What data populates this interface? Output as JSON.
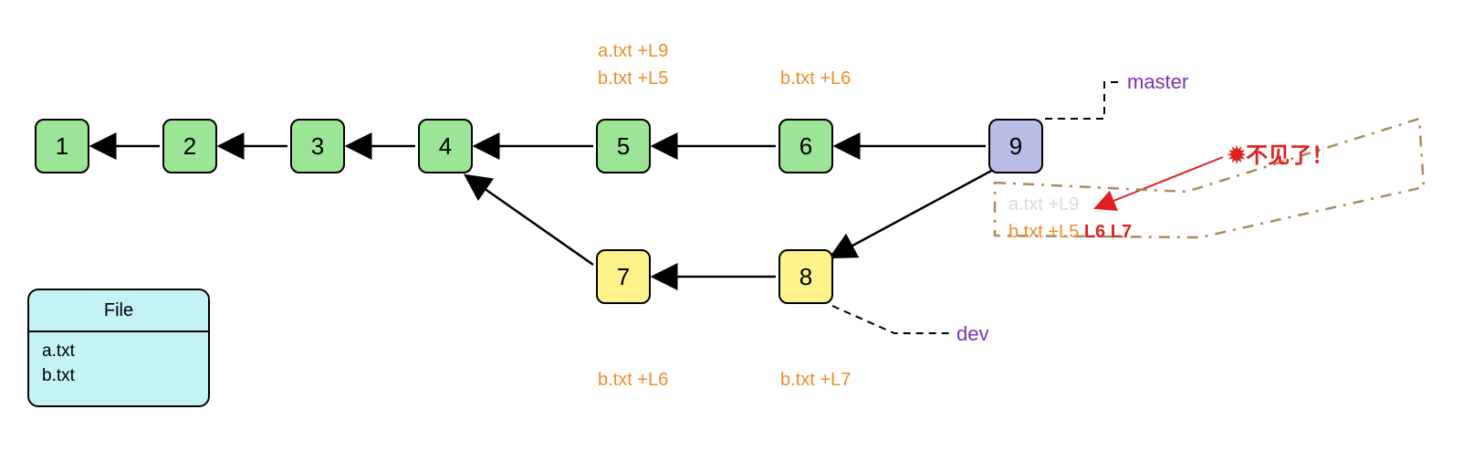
{
  "nodes": {
    "n1": "1",
    "n2": "2",
    "n3": "3",
    "n4": "4",
    "n5": "5",
    "n6": "6",
    "n7": "7",
    "n8": "8",
    "n9": "9"
  },
  "annotations": {
    "c5a": "a.txt +L9",
    "c5b": "b.txt +L5",
    "c6": "b.txt +L6",
    "c7": "b.txt +L6",
    "c8": "b.txt +L7",
    "merged_faded": "a.txt +L9",
    "merged_b_prefix": "b.txt +L5 ",
    "merged_b_red": "L6 L7"
  },
  "branches": {
    "master": "master",
    "dev": "dev"
  },
  "callout": {
    "spark": "✹",
    "text": "不见了！"
  },
  "filebox": {
    "title": "File",
    "files": [
      "a.txt",
      "b.txt"
    ]
  },
  "colors": {
    "green": "#9de596",
    "yellow": "#fdf38a",
    "purple": "#b9bce6",
    "orange": "#f08c28",
    "branch": "#7b2fb5",
    "red": "#e02020",
    "faded": "#dcdcdc",
    "dash": "#a88c5a"
  }
}
